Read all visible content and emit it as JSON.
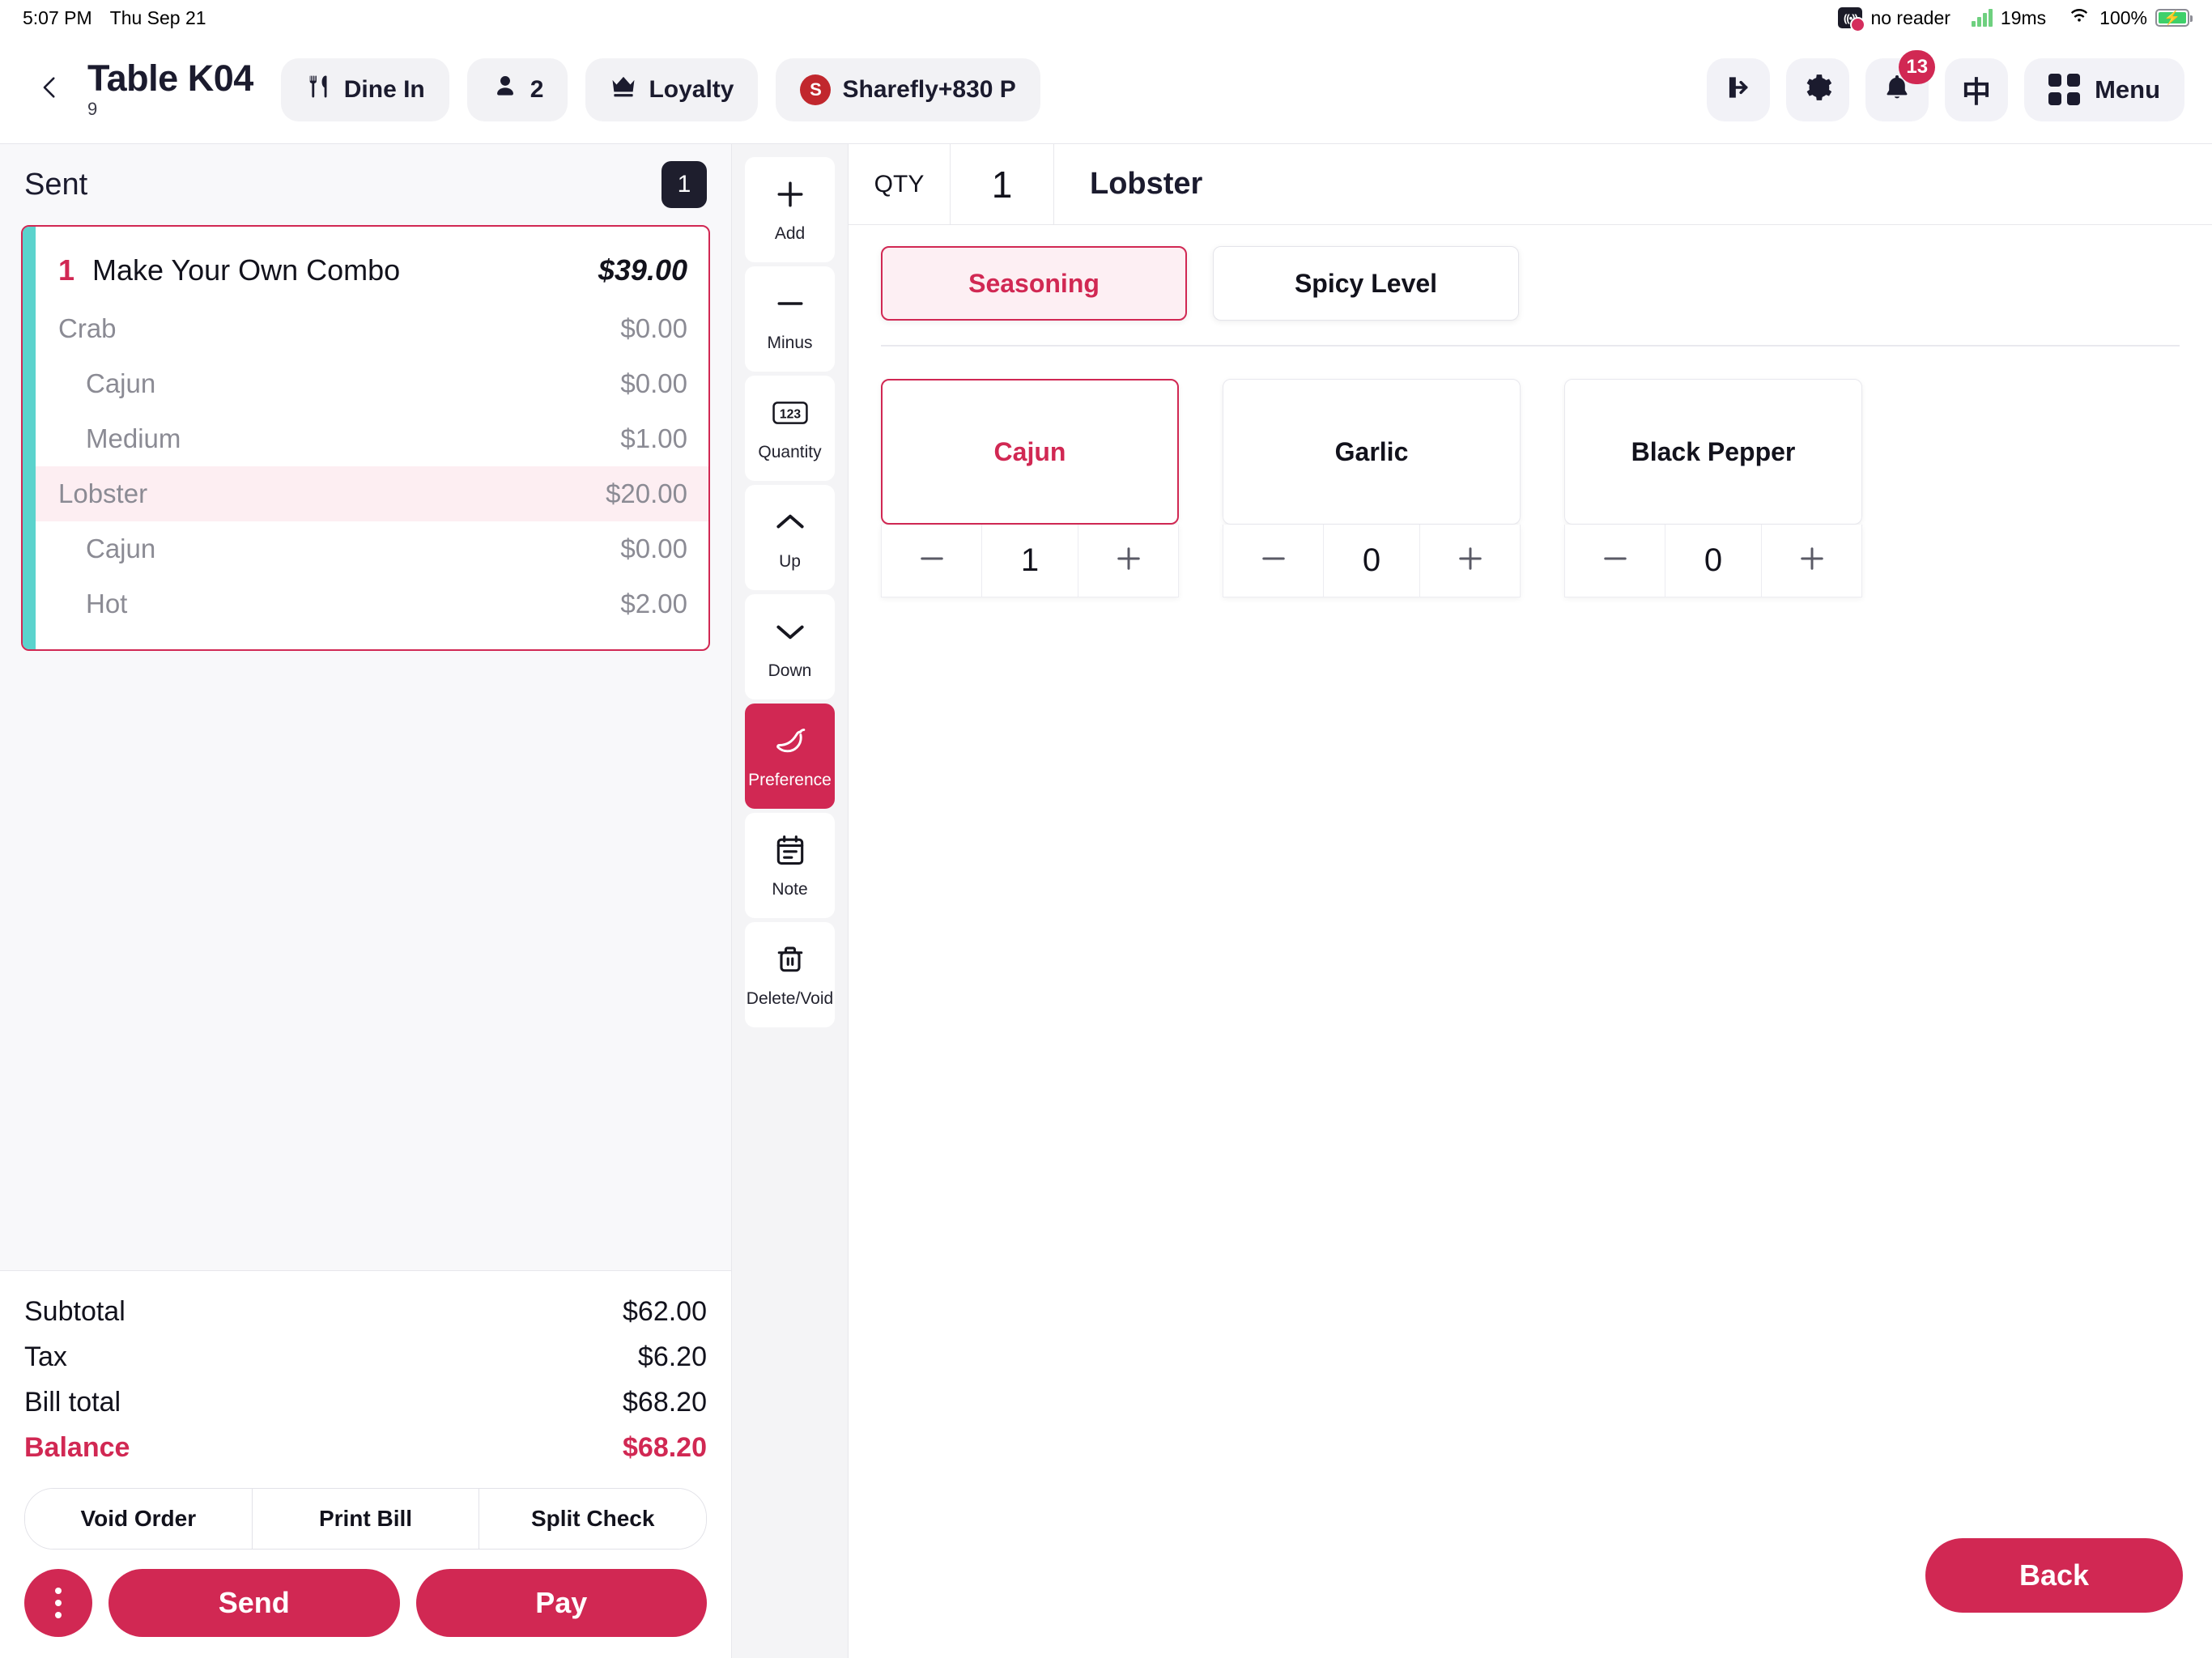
{
  "statusbar": {
    "time": "5:07 PM",
    "date": "Thu Sep 21",
    "reader_status": "no reader",
    "latency": "19ms",
    "battery": "100%"
  },
  "header": {
    "back_icon": "chevron-left-icon",
    "title": "Table K04",
    "subtitle": "9",
    "dine_in_label": "Dine In",
    "guest_count": "2",
    "loyalty_label": "Loyalty",
    "customer_initial": "S",
    "customer_label": "Sharefly+830 P",
    "notification_count": "13",
    "language_label": "中",
    "menu_label": "Menu"
  },
  "order": {
    "status_label": "Sent",
    "item_count": "1",
    "card": {
      "qty": "1",
      "name": "Make Your Own Combo",
      "price": "$39.00",
      "options": [
        {
          "name": "Crab",
          "price": "$0.00",
          "level": 1,
          "selected": false
        },
        {
          "name": "Cajun",
          "price": "$0.00",
          "level": 2,
          "selected": false
        },
        {
          "name": "Medium",
          "price": "$1.00",
          "level": 2,
          "selected": false
        },
        {
          "name": "Lobster",
          "price": "$20.00",
          "level": 1,
          "selected": true
        },
        {
          "name": "Cajun",
          "price": "$0.00",
          "level": 2,
          "selected": false
        },
        {
          "name": "Hot",
          "price": "$2.00",
          "level": 2,
          "selected": false
        }
      ]
    },
    "totals": [
      {
        "label": "Subtotal",
        "value": "$62.00",
        "accent": false
      },
      {
        "label": "Tax",
        "value": "$6.20",
        "accent": false
      },
      {
        "label": "Bill total",
        "value": "$68.20",
        "accent": false
      },
      {
        "label": "Balance",
        "value": "$68.20",
        "accent": true
      }
    ],
    "segment_buttons": [
      "Void Order",
      "Print Bill",
      "Split Check"
    ],
    "more_label": "more-options",
    "send_label": "Send",
    "pay_label": "Pay"
  },
  "rail": {
    "tools": [
      {
        "label": "Add",
        "icon": "plus-icon",
        "active": false
      },
      {
        "label": "Minus",
        "icon": "minus-icon",
        "active": false
      },
      {
        "label": "Quantity",
        "icon": "quantity-123-icon",
        "active": false
      },
      {
        "label": "Up",
        "icon": "chevron-up-icon",
        "active": false
      },
      {
        "label": "Down",
        "icon": "chevron-down-icon",
        "active": false
      },
      {
        "label": "Preference",
        "icon": "chili-pepper-icon",
        "active": true
      },
      {
        "label": "Note",
        "icon": "note-icon",
        "active": false
      },
      {
        "label": "Delete/Void",
        "icon": "trash-icon",
        "active": false
      }
    ]
  },
  "detail": {
    "qty_label": "QTY",
    "qty_value": "1",
    "item_name": "Lobster",
    "tabs": [
      {
        "label": "Seasoning",
        "active": true
      },
      {
        "label": "Spicy Level",
        "active": false
      }
    ],
    "options": [
      {
        "label": "Cajun",
        "count": "1",
        "active": true
      },
      {
        "label": "Garlic",
        "count": "0",
        "active": false
      },
      {
        "label": "Black Pepper",
        "count": "0",
        "active": false
      }
    ],
    "back_label": "Back"
  },
  "colors": {
    "accent": "#d12853",
    "accent_soft": "#fdeff3",
    "dark": "#1b1b2e",
    "teal": "#5bd3cd",
    "muted": "#8b8b94"
  }
}
